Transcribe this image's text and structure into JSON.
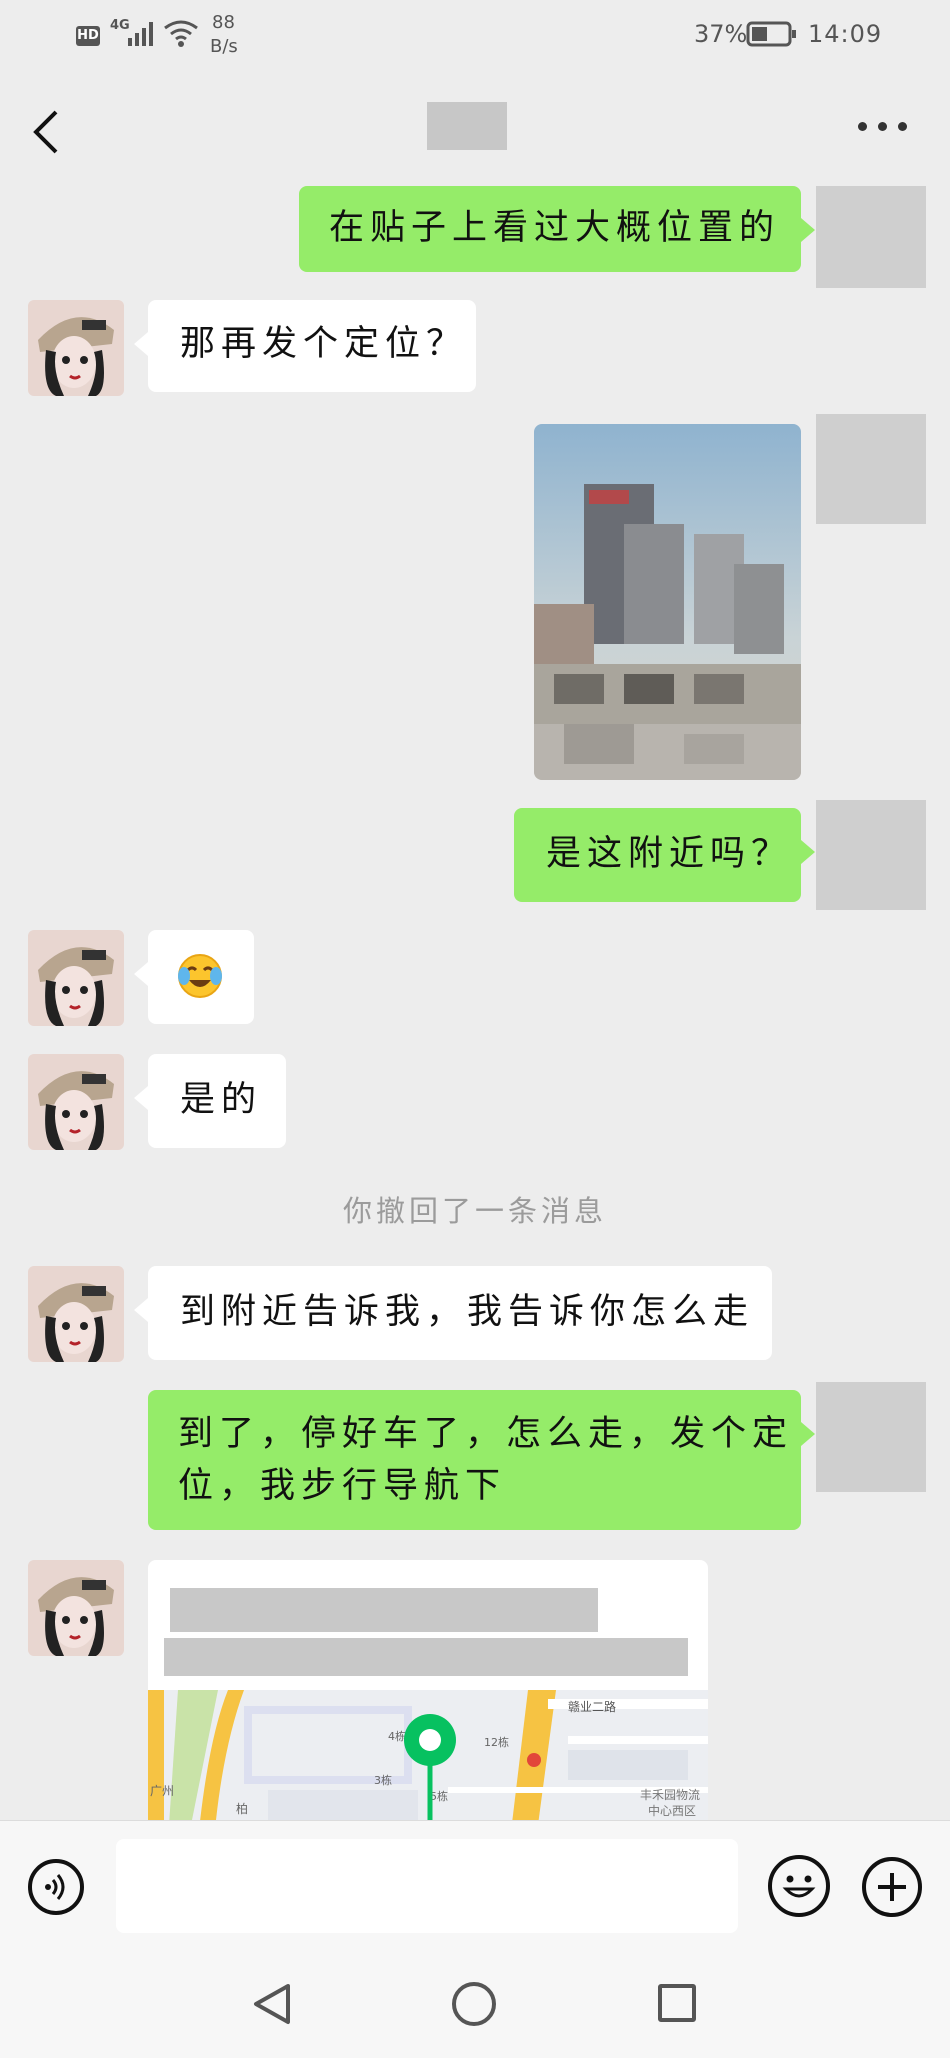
{
  "status_bar": {
    "hd": "HD",
    "net": "4G",
    "speed_value": "88",
    "speed_unit": "B/s",
    "battery": "37%",
    "time": "14:09"
  },
  "messages": [
    {
      "side": "right",
      "type": "text",
      "text": "在贴子上看过大概位置的"
    },
    {
      "side": "left",
      "type": "text",
      "text": "那再发个定位？"
    },
    {
      "side": "right",
      "type": "image",
      "icon": "photo-blurred"
    },
    {
      "side": "right",
      "type": "text",
      "text": "是这附近吗？"
    },
    {
      "side": "left",
      "type": "emoji",
      "icon": "crying-laughing-emoji"
    },
    {
      "side": "left",
      "type": "text",
      "text": "是的"
    },
    {
      "side": "system",
      "type": "notice",
      "text": "你撤回了一条消息"
    },
    {
      "side": "left",
      "type": "text",
      "text": "到附近告诉我，我告诉你怎么走"
    },
    {
      "side": "right",
      "type": "text",
      "text": "到了，停好车了，怎么走，发个定位，我步行导航下",
      "line1": "到了，停好车了，怎么走，发个定",
      "line2": "位，我步行导航下"
    },
    {
      "side": "left",
      "type": "location",
      "map_labels": [
        "赣业二路",
        "4栋",
        "12栋",
        "3栋",
        "5栋",
        "丰禾园物流",
        "中心西区",
        "广州",
        "柏"
      ]
    }
  ],
  "colors": {
    "background": "#ededed",
    "bubble_self": "#95ec69",
    "bubble_other": "#ffffff",
    "map_pin": "#07c160"
  }
}
